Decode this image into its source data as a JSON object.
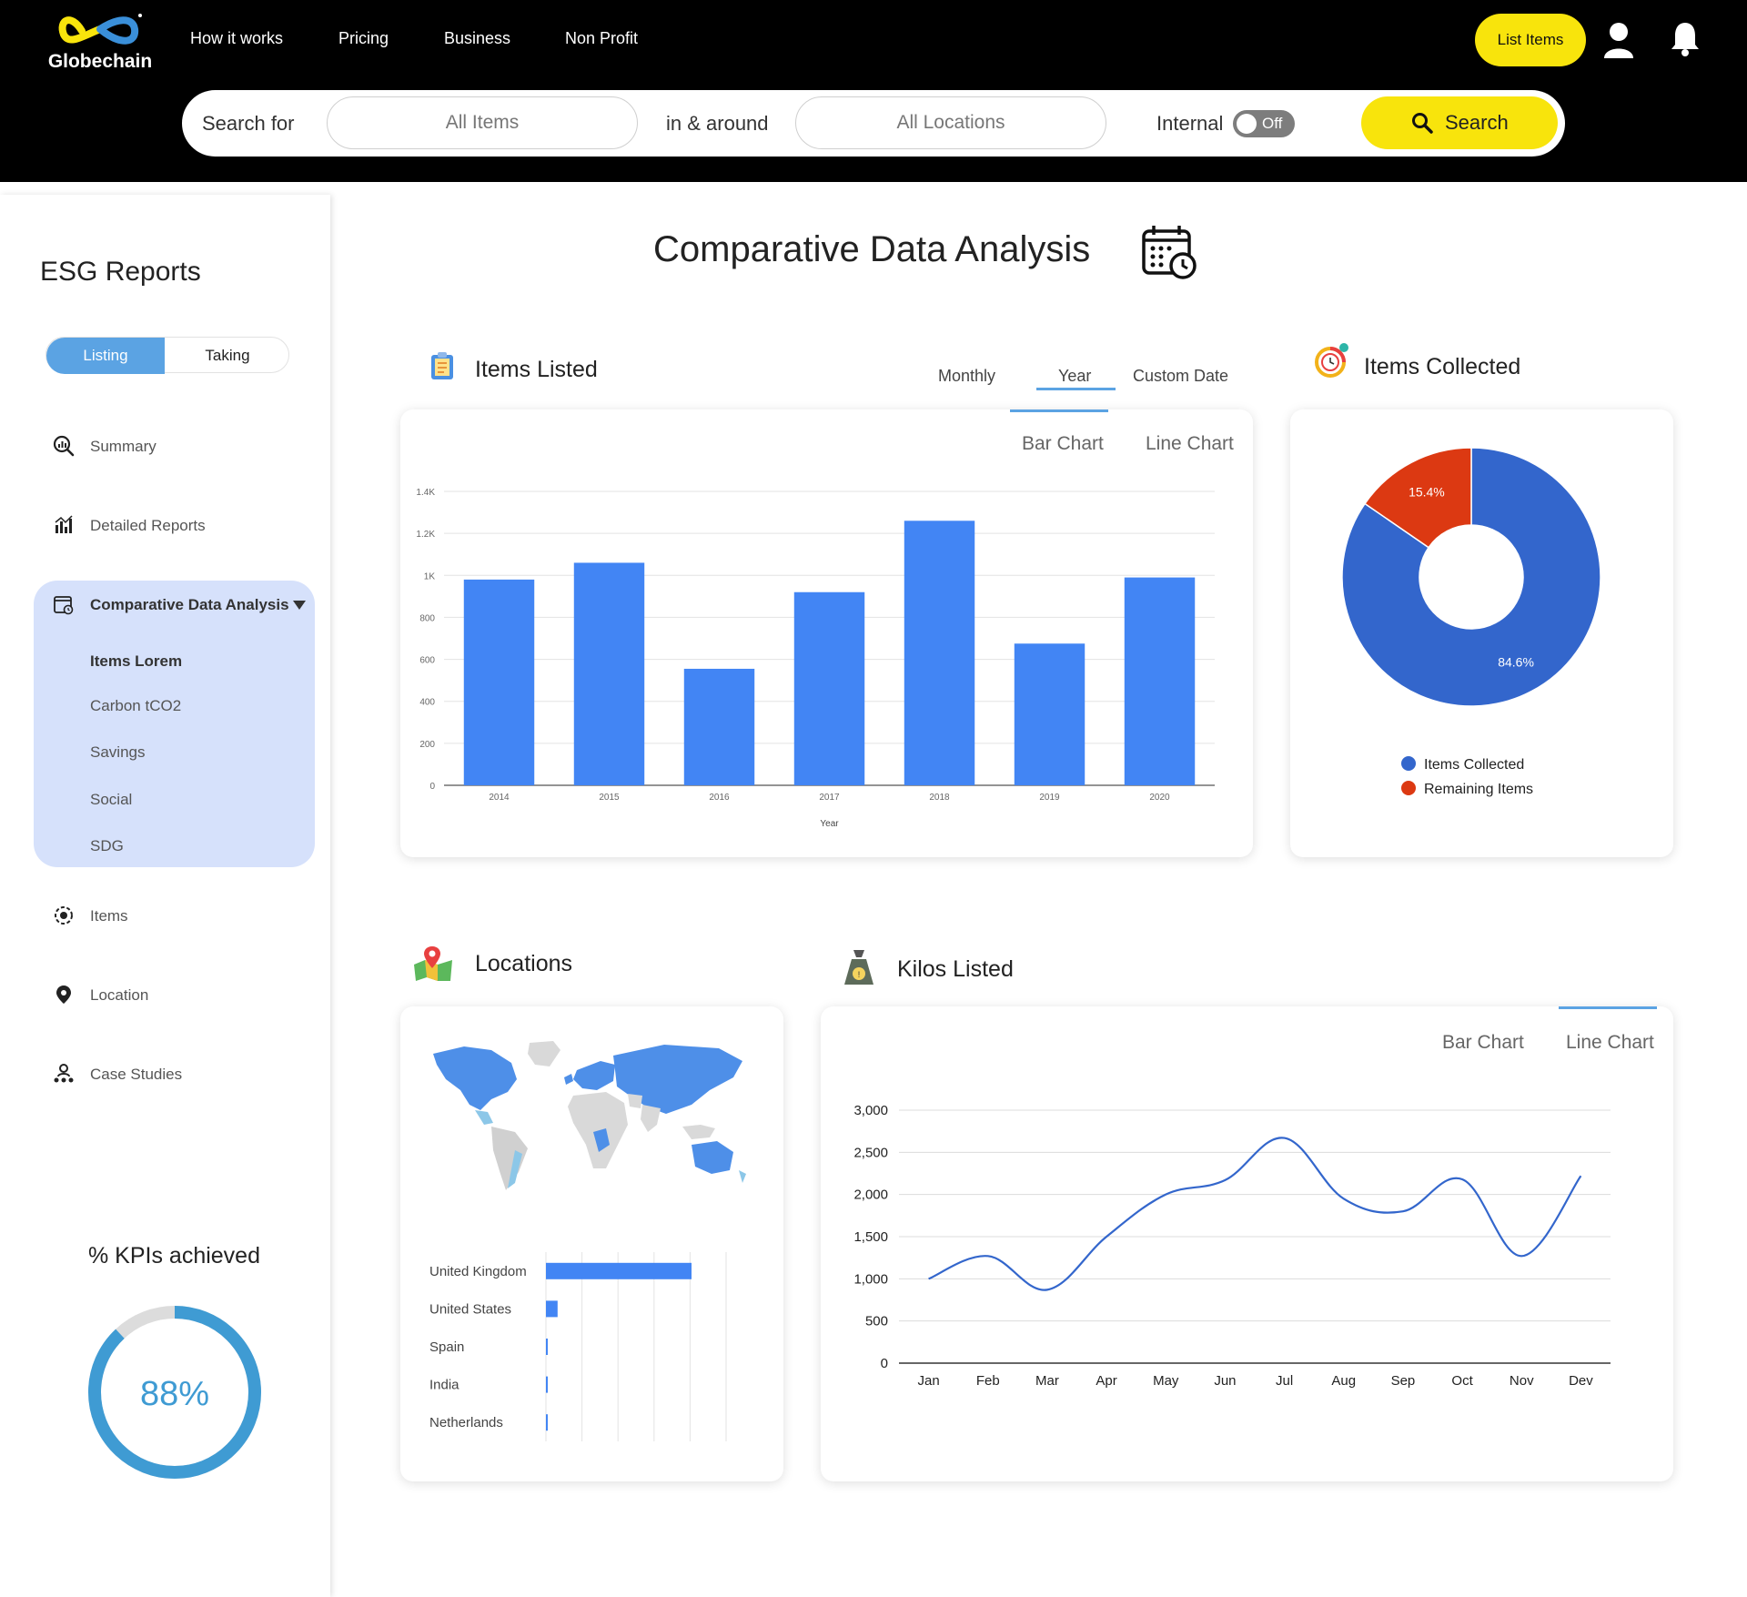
{
  "header": {
    "brand": "Globechain",
    "nav": [
      "How it works",
      "Pricing",
      "Business",
      "Non Profit"
    ],
    "list_items_label": "List Items",
    "icons": [
      "user-icon",
      "bell-icon"
    ],
    "accent_color": "#f8e40c"
  },
  "search": {
    "search_for_label": "Search for",
    "items_value": "All Items",
    "around_label": "in & around",
    "locations_value": "All Locations",
    "internal_label": "Internal",
    "toggle_state": "Off",
    "button_label": "Search"
  },
  "sidebar": {
    "title": "ESG Reports",
    "segments": [
      "Listing",
      "Taking"
    ],
    "active_segment": "Listing",
    "items": [
      {
        "label": "Summary",
        "icon": "magnifier-chart-icon"
      },
      {
        "label": "Detailed Reports",
        "icon": "bar-chart-icon"
      },
      {
        "label": "Comparative Data Analysis",
        "icon": "calendar-clock-icon"
      },
      {
        "label": "Items",
        "icon": "settings-dot-icon"
      },
      {
        "label": "Location",
        "icon": "location-pin-icon"
      },
      {
        "label": "Case Studies",
        "icon": "team-icon"
      }
    ],
    "subitems": [
      "Items Lorem",
      "Carbon tCO2",
      "Savings",
      "Social",
      "SDG"
    ],
    "active_subitem": "Items Lorem",
    "kpi_title": "% KPIs achieved",
    "kpi_value": "88%",
    "kpi_fraction": 0.88
  },
  "main": {
    "title": "Comparative Data Analysis",
    "items_listed": {
      "title": "Items Listed",
      "period_tabs": [
        "Monthly",
        "Year",
        "Custom Date"
      ],
      "active_period": "Year",
      "chart_tabs": [
        "Bar Chart",
        "Line Chart"
      ],
      "active_chart": "Bar Chart"
    },
    "items_collected": {
      "title": "Items Collected"
    },
    "locations": {
      "title": "Locations"
    },
    "kilos_listed": {
      "title": "Kilos Listed",
      "chart_tabs": [
        "Bar Chart",
        "Line Chart"
      ],
      "active_chart": "Line Chart"
    }
  },
  "chart_data": [
    {
      "type": "bar",
      "categories": [
        "2014",
        "2015",
        "2016",
        "2017",
        "2018",
        "2019",
        "2020"
      ],
      "values": [
        980,
        1060,
        555,
        920,
        1260,
        675,
        990
      ],
      "xlabel": "Year",
      "ylim": [
        0,
        1400
      ],
      "yticks": [
        "0",
        "200",
        "400",
        "600",
        "800",
        "1K",
        "1.2K",
        "1.4K"
      ],
      "grid": true,
      "color": "#4285f4"
    },
    {
      "type": "pie",
      "labels": [
        "Items Collected",
        "Remaining Items"
      ],
      "values": [
        84.6,
        15.4
      ],
      "value_labels": [
        "84.6%",
        "15.4%"
      ],
      "colors": [
        "#3366cc",
        "#dc3912"
      ],
      "donut": true,
      "legend": "bottom"
    },
    {
      "type": "bar",
      "orientation": "horizontal",
      "categories": [
        "United Kingdom",
        "United States",
        "Spain",
        "India",
        "Netherlands"
      ],
      "values": [
        100,
        8,
        1,
        1,
        1
      ],
      "color": "#4285f4",
      "grid": true
    },
    {
      "type": "line",
      "categories": [
        "Jan",
        "Feb",
        "Mar",
        "Apr",
        "May",
        "Jun",
        "Jul",
        "Aug",
        "Sep",
        "Oct",
        "Nov",
        "Dev"
      ],
      "values": [
        1000,
        1270,
        870,
        1500,
        2000,
        2170,
        2670,
        1950,
        1800,
        2180,
        1270,
        2220
      ],
      "ylim": [
        0,
        3000
      ],
      "yticks": [
        "0",
        "500",
        "1,000",
        "1,500",
        "2,000",
        "2,500",
        "3,000"
      ],
      "grid": true,
      "color": "#3366cc"
    }
  ]
}
